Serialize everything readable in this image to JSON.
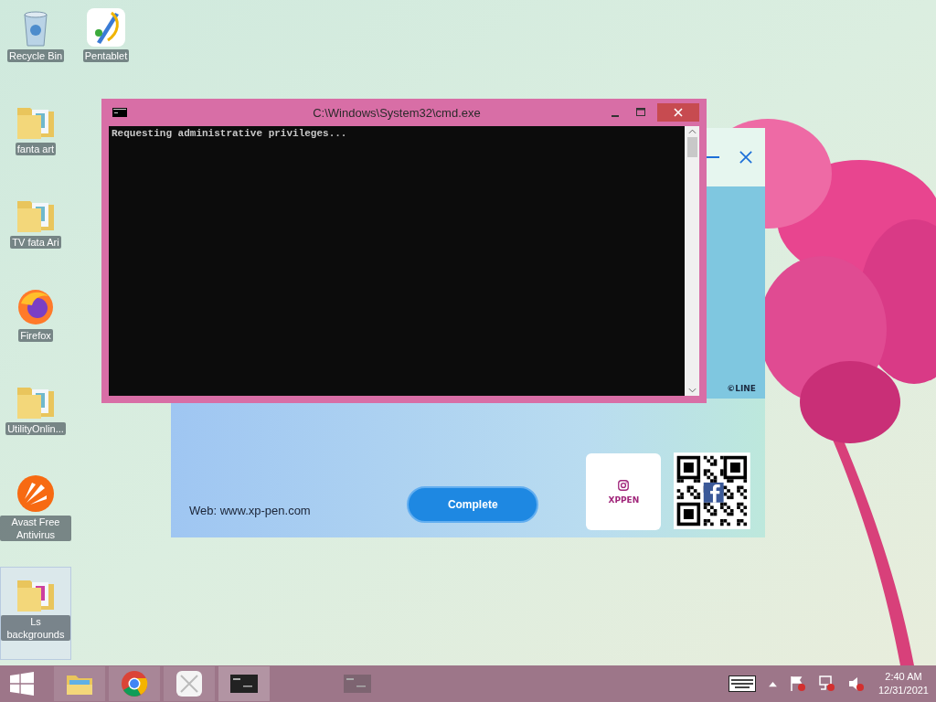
{
  "desktop_icons": [
    {
      "label": "Recycle Bin",
      "kind": "recycle",
      "selected": false
    },
    {
      "label": "Pentablet",
      "kind": "app",
      "selected": false
    },
    {
      "label": "fanta art",
      "kind": "folder",
      "selected": false
    },
    {
      "label": "TV  fata Ari",
      "kind": "folder",
      "selected": false
    },
    {
      "label": "Firefox",
      "kind": "firefox",
      "selected": false
    },
    {
      "label": "UtilityOnlin...",
      "kind": "folder",
      "selected": false
    },
    {
      "label": "Avast Free Antivirus",
      "kind": "avast",
      "selected": false
    },
    {
      "label": "Ls backgrounds",
      "kind": "folder",
      "selected": true
    }
  ],
  "installer": {
    "credit": "©LINE",
    "web": "Web: www.xp-pen.com",
    "button": "Complete",
    "instagram_name": "XPPEN"
  },
  "cmd_window": {
    "title": "C:\\Windows\\System32\\cmd.exe",
    "lines": [
      "Requesting administrative privileges..."
    ]
  },
  "taskbar": {
    "items": [
      {
        "kind": "explorer",
        "selected": false
      },
      {
        "kind": "chrome",
        "selected": false
      },
      {
        "kind": "pentablet",
        "selected": false
      },
      {
        "kind": "console",
        "selected": true
      },
      {
        "kind": "console",
        "selected": false
      }
    ],
    "time": "2:40 AM",
    "date": "12/31/2021"
  }
}
